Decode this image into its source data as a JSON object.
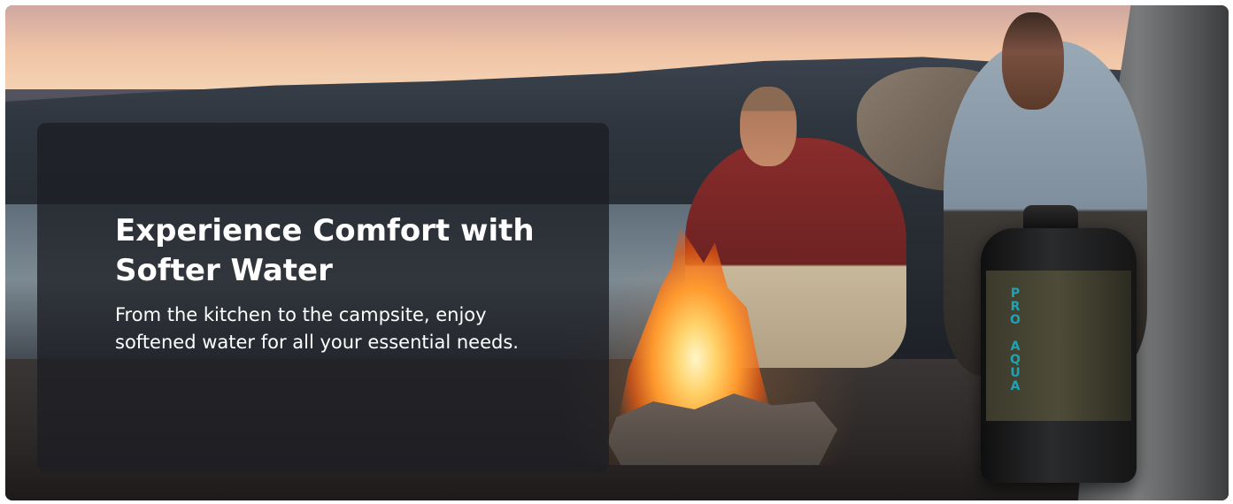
{
  "hero": {
    "headline": "Experience Comfort with Softer Water",
    "subtext": "From the kitchen to the campsite, enjoy softened water for all your essential needs.",
    "product_logo": "PRO AQUA",
    "image_alt": "Campers roasting marshmallows around a campfire at dusk next to a portable water softener"
  }
}
